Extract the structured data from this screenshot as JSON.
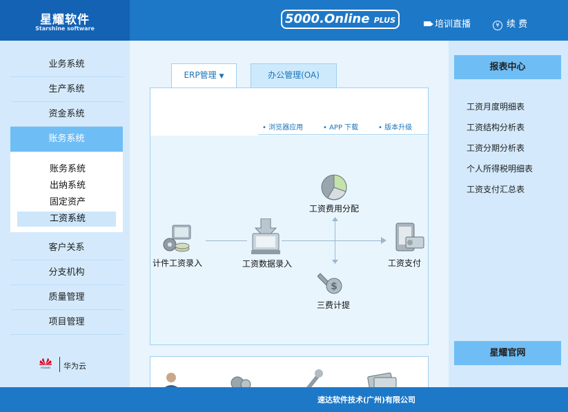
{
  "header": {
    "logo_title": "星耀软件",
    "logo_subtitle": "Starshine software",
    "product_main": "5000.Online",
    "product_suffix": "PLUS",
    "live_label": "培训直播",
    "renew_label": "续 费",
    "renew_icon_glyph": "¥"
  },
  "sidebar": {
    "items": [
      {
        "label": "业务系统"
      },
      {
        "label": "生产系统"
      },
      {
        "label": "资金系统"
      },
      {
        "label": "账务系统"
      },
      {
        "label": "客户关系"
      },
      {
        "label": "分支机构"
      },
      {
        "label": "质量管理"
      },
      {
        "label": "项目管理"
      }
    ],
    "active_index": 3,
    "subitems": [
      {
        "label": "账务系统"
      },
      {
        "label": "出纳系统"
      },
      {
        "label": "固定资产"
      },
      {
        "label": "工资系统"
      }
    ],
    "selected_sub_index": 3,
    "partner": {
      "text": "华为云",
      "logo_text": "HUAWEI"
    }
  },
  "tabs": [
    {
      "label": "ERP管理",
      "arrow": "▼"
    },
    {
      "label": "办公管理(OA)"
    }
  ],
  "links": [
    {
      "label": "浏览器应用"
    },
    {
      "label": "APP 下载"
    },
    {
      "label": "版本升级"
    }
  ],
  "link_bullet": "•",
  "flow": {
    "piece_wage": "计件工资录入",
    "wage_entry": "工资数据录入",
    "cost_alloc": "工资费用分配",
    "three_fee": "三费计提",
    "payment": "工资支付"
  },
  "report": {
    "title": "报表中心",
    "items": [
      {
        "label": "工资月度明细表"
      },
      {
        "label": "工资结构分析表"
      },
      {
        "label": "工资分期分析表"
      },
      {
        "label": "个人所得税明细表"
      },
      {
        "label": "工资支付汇总表"
      }
    ],
    "official_site": "星耀官网"
  },
  "footer": {
    "text": "速达软件技术(广州)有限公司"
  },
  "colors": {
    "header_blue": "#1e78c8",
    "logo_blue": "#1462b4",
    "sidebar_bg": "#d4eafc",
    "active_blue": "#6fbdf5",
    "link_blue": "#1b73b8",
    "panel_bg": "#e9f4fd"
  }
}
